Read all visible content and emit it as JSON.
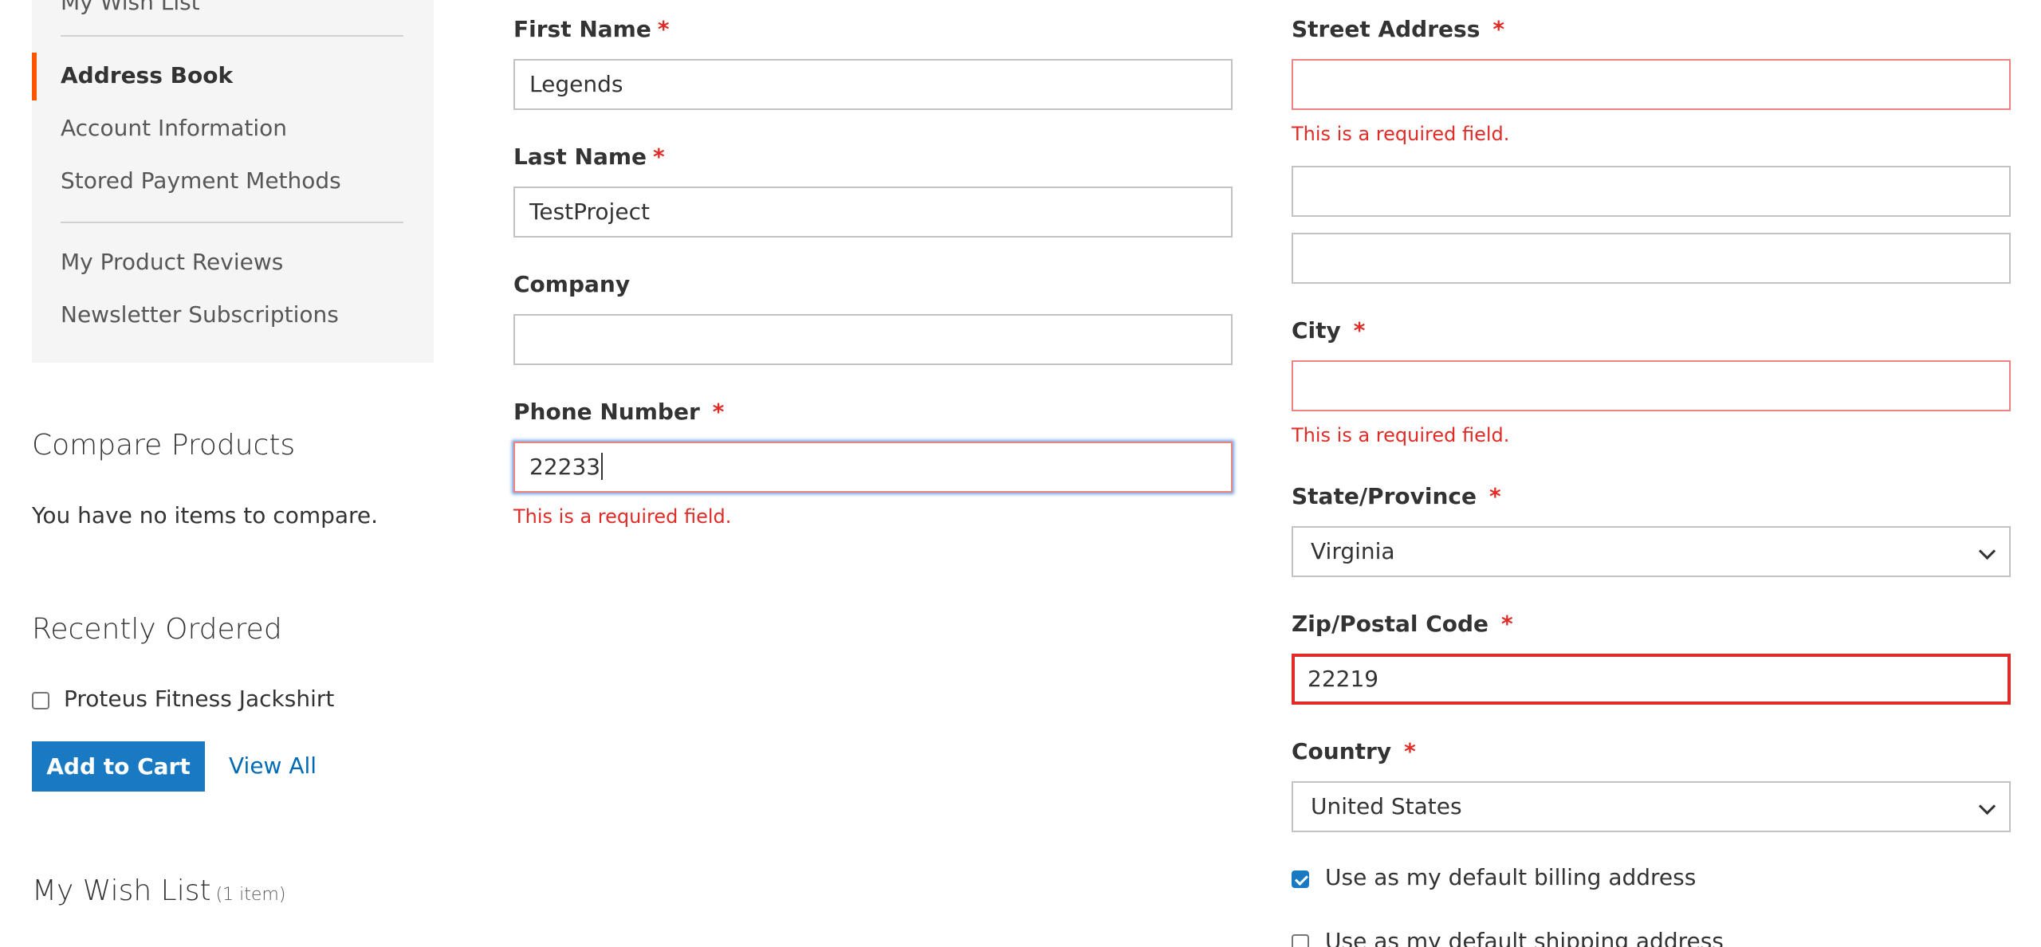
{
  "sidebar": {
    "partial_top_item": "My Wish List",
    "items": [
      {
        "label": "Address Book",
        "current": true
      },
      {
        "label": "Account Information"
      },
      {
        "label": "Stored Payment Methods"
      },
      {
        "label": "My Product Reviews"
      },
      {
        "label": "Newsletter Subscriptions"
      }
    ],
    "accent_color": "#ff5501"
  },
  "compare": {
    "title": "Compare Products",
    "empty_text": "You have no items to compare."
  },
  "recently_ordered": {
    "title": "Recently Ordered",
    "item": {
      "label": "Proteus Fitness Jackshirt",
      "checked": false
    },
    "add_to_cart": "Add to Cart",
    "view_all": "View All"
  },
  "wishlist": {
    "title": "My Wish List",
    "counter": "(1 item)"
  },
  "form": {
    "required_marker": "*",
    "error_text": "This is a required field.",
    "first_name": {
      "label": "First Name",
      "value": "Legends"
    },
    "last_name": {
      "label": "Last Name",
      "value": "TestProject"
    },
    "company": {
      "label": "Company",
      "value": ""
    },
    "phone": {
      "label": "Phone Number",
      "value": "22233"
    },
    "street": {
      "label": "Street Address",
      "line1": "",
      "line2": "",
      "line3": ""
    },
    "city": {
      "label": "City",
      "value": ""
    },
    "state": {
      "label": "State/Province",
      "value": "Virginia"
    },
    "zip": {
      "label": "Zip/Postal Code",
      "value": "22219"
    },
    "country": {
      "label": "Country",
      "value": "United States"
    },
    "default_billing": {
      "label": "Use as my default billing address",
      "checked": true
    },
    "default_shipping": {
      "label": "Use as my default shipping address",
      "checked": false
    }
  },
  "colors": {
    "primary_button": "#1979c3",
    "link": "#006bb4",
    "error": "#e02b27"
  }
}
